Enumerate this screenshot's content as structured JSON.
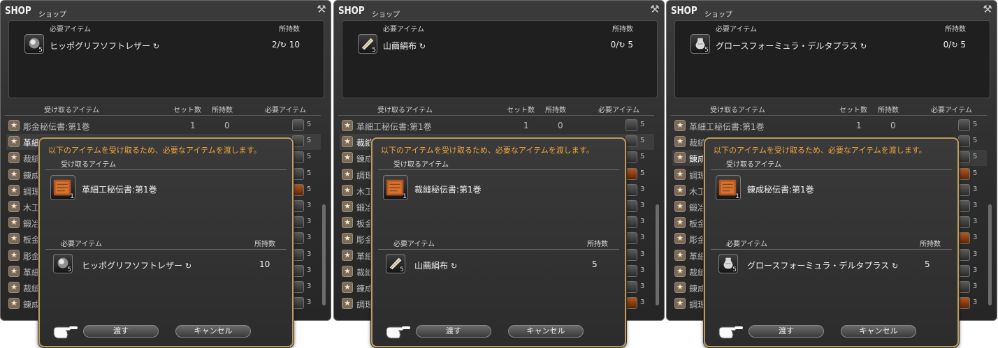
{
  "shop": {
    "title": "SHOP",
    "subtitle": "ショップ",
    "required_header": "必要アイテム",
    "owned_header": "所持数",
    "list_headers": {
      "receive": "受け取るアイテム",
      "sets": "セット数",
      "owned": "所持数",
      "required": "必要アイテム"
    }
  },
  "dialog": {
    "message": "以下のアイテムを受け取るため、必要なアイテムを渡します。",
    "receive_header": "受け取るアイテム",
    "required_header": "必要アイテム",
    "owned_header": "所持数",
    "give_label": "渡す",
    "cancel_label": "キャンセル"
  },
  "panels": [
    {
      "top_item": {
        "name": "ヒッポグリフソフトレザー",
        "count": "5",
        "have": "2/",
        "need": "10"
      },
      "rows": [
        {
          "name": "彫金秘伝書:第1巻",
          "sets": "1",
          "owned": "0",
          "req": "5",
          "icon": "gray",
          "selected": false
        },
        {
          "name": "革細",
          "sets": "",
          "owned": "",
          "req": "5",
          "icon": "gray",
          "selected": true
        },
        {
          "name": "裁縫",
          "sets": "",
          "owned": "",
          "req": "5",
          "icon": "gray",
          "selected": false
        },
        {
          "name": "錬成",
          "sets": "",
          "owned": "",
          "req": "5",
          "icon": "gray",
          "selected": false
        },
        {
          "name": "調理",
          "sets": "",
          "owned": "",
          "req": "5",
          "icon": "bk",
          "selected": false
        },
        {
          "name": "木工",
          "sets": "",
          "owned": "",
          "req": "3",
          "icon": "gray",
          "selected": false
        },
        {
          "name": "鍛冶",
          "sets": "",
          "owned": "",
          "req": "3",
          "icon": "gray",
          "selected": false
        },
        {
          "name": "板金",
          "sets": "",
          "owned": "",
          "req": "3",
          "icon": "gray",
          "selected": false
        },
        {
          "name": "彫金",
          "sets": "",
          "owned": "",
          "req": "3",
          "icon": "gray",
          "selected": false
        },
        {
          "name": "革細",
          "sets": "",
          "owned": "",
          "req": "3",
          "icon": "gray",
          "selected": false
        },
        {
          "name": "裁縫",
          "sets": "",
          "owned": "",
          "req": "3",
          "icon": "gray",
          "selected": false
        },
        {
          "name": "錬成",
          "sets": "",
          "owned": "",
          "req": "3",
          "icon": "gray",
          "selected": false
        }
      ],
      "dialog_receive": {
        "name": "革細工秘伝書:第1巻",
        "count": "1"
      },
      "dialog_required": {
        "name": "ヒッポグリフソフトレザー",
        "count": "5",
        "owned": "10"
      }
    },
    {
      "top_item": {
        "name": "山繭絹布",
        "count": "5",
        "have": "0/",
        "need": "5"
      },
      "rows": [
        {
          "name": "革細工秘伝書:第1巻",
          "sets": "1",
          "owned": "0",
          "req": "5",
          "icon": "gray",
          "selected": false
        },
        {
          "name": "裁縫",
          "sets": "",
          "owned": "",
          "req": "5",
          "icon": "gray",
          "selected": true
        },
        {
          "name": "錬成",
          "sets": "",
          "owned": "",
          "req": "5",
          "icon": "gray",
          "selected": false
        },
        {
          "name": "調理",
          "sets": "",
          "owned": "",
          "req": "5",
          "icon": "bk",
          "selected": false
        },
        {
          "name": "木工",
          "sets": "",
          "owned": "",
          "req": "3",
          "icon": "gray",
          "selected": false
        },
        {
          "name": "鍛冶",
          "sets": "",
          "owned": "",
          "req": "3",
          "icon": "gray",
          "selected": false
        },
        {
          "name": "板金",
          "sets": "",
          "owned": "",
          "req": "3",
          "icon": "gray",
          "selected": false
        },
        {
          "name": "彫金",
          "sets": "",
          "owned": "",
          "req": "3",
          "icon": "gray",
          "selected": false
        },
        {
          "name": "革細",
          "sets": "",
          "owned": "",
          "req": "3",
          "icon": "gray",
          "selected": false
        },
        {
          "name": "裁縫",
          "sets": "",
          "owned": "",
          "req": "3",
          "icon": "gray",
          "selected": false
        },
        {
          "name": "錬成",
          "sets": "",
          "owned": "",
          "req": "3",
          "icon": "gray",
          "selected": false
        },
        {
          "name": "調理",
          "sets": "",
          "owned": "",
          "req": "3",
          "icon": "bk",
          "selected": false
        }
      ],
      "dialog_receive": {
        "name": "裁縫秘伝書:第1巻",
        "count": "1"
      },
      "dialog_required": {
        "name": "山繭絹布",
        "count": "5",
        "owned": "5"
      }
    },
    {
      "top_item": {
        "name": "グロースフォーミュラ・デルタプラス",
        "count": "5",
        "have": "0/",
        "need": "5"
      },
      "rows": [
        {
          "name": "革細工秘伝書:第1巻",
          "sets": "1",
          "owned": "0",
          "req": "5",
          "icon": "gray",
          "selected": false
        },
        {
          "name": "裁縫",
          "sets": "",
          "owned": "",
          "req": "5",
          "icon": "gray",
          "selected": false
        },
        {
          "name": "錬成",
          "sets": "",
          "owned": "",
          "req": "5",
          "icon": "gray",
          "selected": true
        },
        {
          "name": "調理",
          "sets": "",
          "owned": "",
          "req": "5",
          "icon": "bk",
          "selected": false
        },
        {
          "name": "木工",
          "sets": "",
          "owned": "",
          "req": "3",
          "icon": "gray",
          "selected": false
        },
        {
          "name": "鍛冶",
          "sets": "",
          "owned": "",
          "req": "3",
          "icon": "gray",
          "selected": false
        },
        {
          "name": "板金",
          "sets": "",
          "owned": "",
          "req": "3",
          "icon": "gray",
          "selected": false
        },
        {
          "name": "彫金",
          "sets": "",
          "owned": "",
          "req": "3",
          "icon": "bk",
          "selected": false
        },
        {
          "name": "革細",
          "sets": "",
          "owned": "",
          "req": "3",
          "icon": "gray",
          "selected": false
        },
        {
          "name": "裁縫",
          "sets": "",
          "owned": "",
          "req": "3",
          "icon": "gray",
          "selected": false
        },
        {
          "name": "錬成",
          "sets": "",
          "owned": "",
          "req": "3",
          "icon": "gray",
          "selected": false
        },
        {
          "name": "調理",
          "sets": "",
          "owned": "",
          "req": "3",
          "icon": "bk",
          "selected": false
        }
      ],
      "dialog_receive": {
        "name": "錬成秘伝書:第1巻",
        "count": "1"
      },
      "dialog_required": {
        "name": "グロースフォーミュラ・デルタプラス",
        "count": "5",
        "owned": "5"
      }
    }
  ],
  "icons": {
    "shop_tool": "crossed-tools-icon",
    "hq": "hq-icon",
    "row_star": "favorite-star-icon",
    "pointer": "pointing-hand-icon"
  },
  "colors": {
    "accent": "#f0a73b",
    "frame_gold": "#b99b64"
  }
}
